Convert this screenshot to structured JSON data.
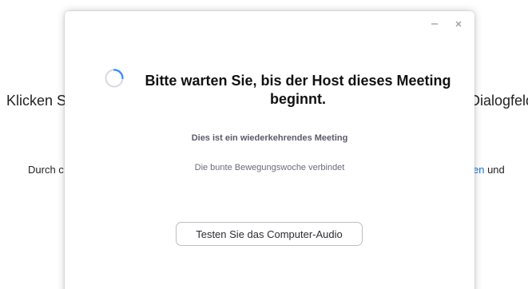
{
  "background": {
    "line1_left": "Klicken S",
    "line1_right": "Dialogfeld",
    "line2_left": "Durch c",
    "line2_right_link": "en",
    "line2_right_text": " und"
  },
  "dialog": {
    "controls": {
      "minimize_icon": "minimize-icon",
      "close_icon": "close-icon"
    },
    "spinner_icon": "loading-spinner-icon",
    "heading_line1": "Bitte warten Sie, bis der Host dieses Meeting",
    "heading_line2": "beginnt.",
    "recurring_note": "Dies ist ein wiederkehrendes Meeting",
    "meeting_topic": "Die bunte Bewegungswoche verbindet",
    "audio_button_label": "Testen Sie das Computer-Audio"
  },
  "colors": {
    "spinner_track": "#d9dde3",
    "spinner_arc": "#2d8cff",
    "link": "#1a6fd6"
  }
}
